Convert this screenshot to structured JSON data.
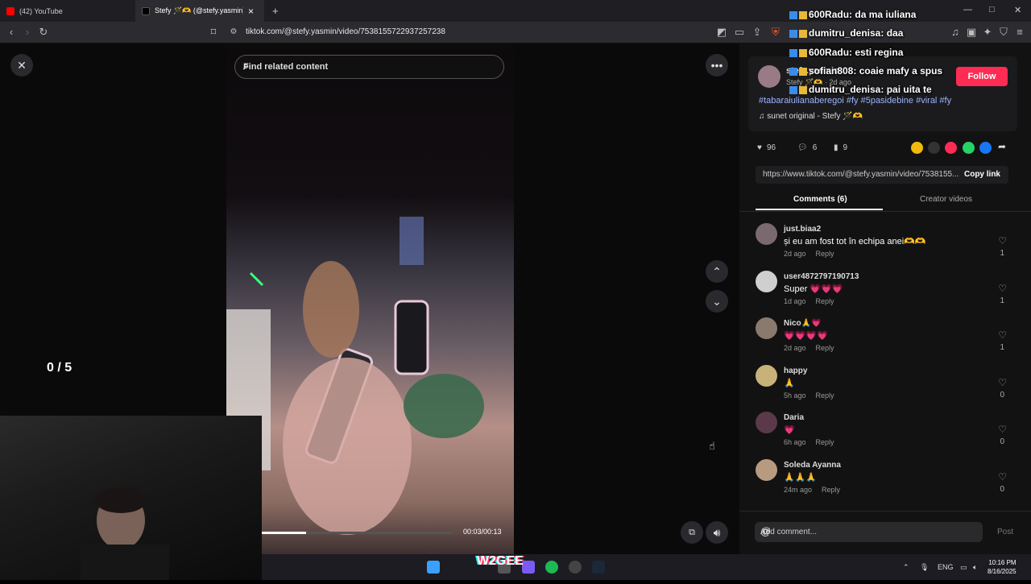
{
  "browser": {
    "tabs": [
      {
        "label": "(42) YouTube",
        "fav_color": "#ff0000"
      },
      {
        "label": "Stefy 🪄🫶 (@stefy.yasmin) |",
        "fav_color": "#111111"
      }
    ],
    "url": "tiktok.com/@stefy.yasmin/video/7538155722937257238",
    "new_tab": "+",
    "close_tab": "×"
  },
  "player": {
    "search_placeholder": "Find related content",
    "counter": "0  / 5",
    "time": "00:03/00:13",
    "progress": 0.23
  },
  "post": {
    "author": "stefy.yasmin",
    "author_sub": "Stefy 🪄🫶 · 2d ago",
    "follow_label": "Follow",
    "hashtags": "#tabaraiulianaberegoi #fy #5pasidebine #viral #fy",
    "sound": "sunet original - Stefy 🪄🫶",
    "likes": "96",
    "comments": "6",
    "saves": "9",
    "link": "https://www.tiktok.com/@stefy.yasmin/video/7538155...",
    "copy_link": "Copy link",
    "tab_comments": "Comments (6)",
    "tab_creator": "Creator videos",
    "add_comment": "Add comment...",
    "post_label": "Post"
  },
  "comments": [
    {
      "user": "just.biaa2",
      "text": "și eu am fost tot în echipa anei🫶🫶",
      "time": "2d ago",
      "reply": "Reply",
      "likes": "1",
      "av": "#7a6a70"
    },
    {
      "user": "user4872797190713",
      "text": "Super 💗💗💗",
      "time": "1d ago",
      "reply": "Reply",
      "likes": "1",
      "av": "#cfcfcf"
    },
    {
      "user": "Nico🙏💗",
      "text": "💗💗💗💗",
      "time": "2d ago",
      "reply": "Reply",
      "likes": "1",
      "av": "#8a7a6e"
    },
    {
      "user": "happy",
      "text": "🙏",
      "time": "5h ago",
      "reply": "Reply",
      "likes": "0",
      "av": "#c9b27a"
    },
    {
      "user": "Daria",
      "text": "💗",
      "time": "6h ago",
      "reply": "Reply",
      "likes": "0",
      "av": "#5a3a4a"
    },
    {
      "user": "Soleda Ayanna",
      "text": "🙏🙏🙏",
      "time": "24m ago",
      "reply": "Reply",
      "likes": "0",
      "av": "#b89a80"
    }
  ],
  "chat": [
    {
      "user": "600Radu",
      "msg": "da ma iuliana",
      "color": "#ffffff"
    },
    {
      "user": "dumitru_denisa",
      "msg": "daa",
      "color": "#ffffff"
    },
    {
      "user": "600Radu",
      "msg": "esti regina",
      "color": "#ffffff"
    },
    {
      "user": "sofian808",
      "msg": "coaie mafy a spus",
      "color": "#ffffff"
    },
    {
      "user": "dumitru_denisa",
      "msg": "pai uita te",
      "color": "#ffffff"
    }
  ],
  "taskbar": {
    "overlay": "W2GEE",
    "lang": "ENG",
    "time": "10:16 PM",
    "date": "8/16/2025"
  }
}
